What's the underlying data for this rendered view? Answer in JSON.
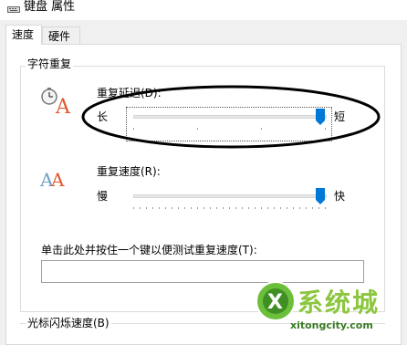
{
  "window": {
    "title": "键盘 属性"
  },
  "tabs": [
    {
      "label": "速度",
      "active": true
    },
    {
      "label": "硬件",
      "active": false
    }
  ],
  "char_repeat": {
    "group_title": "字符重复",
    "delay": {
      "label": "重复延迟(D):",
      "left_label": "长",
      "right_label": "短",
      "value_fraction": 1.0
    },
    "rate": {
      "label": "重复速度(R):",
      "left_label": "慢",
      "right_label": "快",
      "value_fraction": 1.0
    },
    "test": {
      "label": "单击此处并按住一个键以便测试重复速度(T):",
      "value": ""
    }
  },
  "cursor_blink": {
    "group_title": "光标闪烁速度(B)"
  },
  "watermark": {
    "brand": "系统城",
    "url": "xitongcity.com"
  },
  "colors": {
    "thumb": "#0078d7",
    "ellipse": "#000000",
    "watermark_green": "#8cc63f"
  },
  "icons": {
    "title": "keyboard-icon",
    "delay": "stopwatch-letter-icon",
    "rate": "repeating-letters-icon"
  }
}
